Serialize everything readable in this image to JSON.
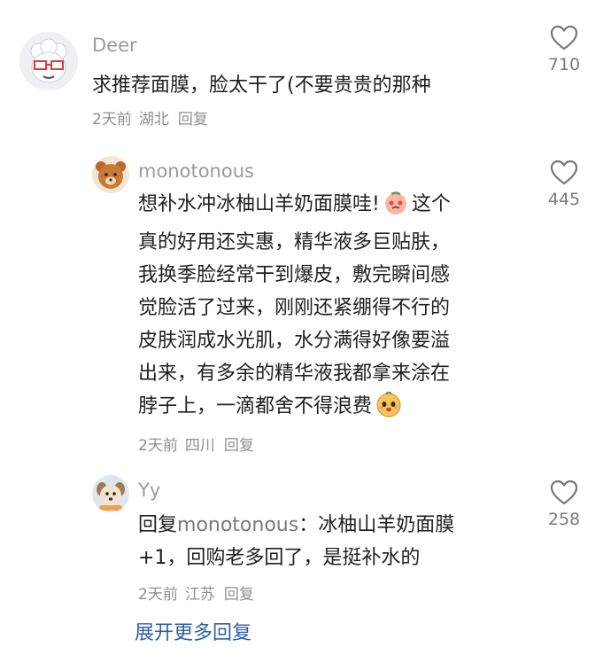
{
  "comments": [
    {
      "user": "Deer",
      "text": "求推荐面膜，脸太干了(不要贵贵的那种",
      "time": "2天前",
      "location": "湖北",
      "reply_label": "回复",
      "likes": "710"
    },
    {
      "user": "monotonous",
      "text_lines": [
        "想补水冲冰柚山羊奶面膜哇!",
        "这个",
        "真的好用还实惠，精华液多巨贴肤，",
        "我换季脸经常干到爆皮，敷完瞬间感",
        "觉脸活了过来，刚刚还紧绷得不行的",
        "皮肤润成水光肌，水分满得好像要溢",
        "出来，有多余的精华液我都拿来涂在",
        "脖子上，一滴都舍不得浪费"
      ],
      "time": "2天前",
      "location": "四川",
      "reply_label": "回复",
      "likes": "445"
    },
    {
      "user": "Yy",
      "reply_prefix": "回复",
      "reply_to": "monotonous",
      "text_line1": "：冰柚山羊奶面膜",
      "text_line2": "+1，回购老多回了，是挺补水的",
      "time": "2天前",
      "location": "江苏",
      "reply_label": "回复",
      "likes": "258"
    }
  ],
  "expand_more": "展开更多回复",
  "icons": {
    "like": "heart-outline-icon",
    "emoji1": "blushing-emoji-icon",
    "emoji2": "tearful-emoji-icon"
  },
  "colors": {
    "link": "#2f5fa8",
    "meta": "#8f8f8f",
    "username": "#9a9a9a"
  }
}
